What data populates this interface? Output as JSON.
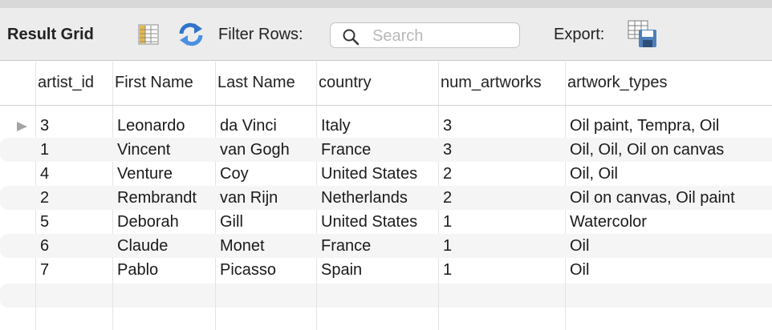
{
  "toolbar": {
    "title": "Result Grid",
    "filter_label": "Filter Rows:",
    "search_placeholder": "Search",
    "export_label": "Export:",
    "icons": [
      "form-editor-icon",
      "refresh-icon",
      "search-icon",
      "export-icon"
    ]
  },
  "grid": {
    "columns": [
      "artist_id",
      "First Name",
      "Last Name",
      "country",
      "num_artworks",
      "artwork_types"
    ],
    "rows": [
      [
        "3",
        "Leonardo",
        "da Vinci",
        "Italy",
        "3",
        "Oil paint, Tempra, Oil"
      ],
      [
        "1",
        "Vincent",
        "van Gogh",
        "France",
        "3",
        "Oil, Oil, Oil on canvas"
      ],
      [
        "4",
        "Venture",
        "Coy",
        "United States",
        "2",
        "Oil, Oil"
      ],
      [
        "2",
        "Rembrandt",
        "van Rijn",
        "Netherlands",
        "2",
        "Oil on canvas, Oil paint"
      ],
      [
        "5",
        "Deborah",
        "Gill",
        "United States",
        "1",
        "Watercolor"
      ],
      [
        "6",
        "Claude",
        "Monet",
        "France",
        "1",
        "Oil"
      ],
      [
        "7",
        "Pablo",
        "Picasso",
        "Spain",
        "1",
        "Oil"
      ]
    ]
  },
  "colors": {
    "toolbar_bg": "#ececec",
    "alt_row": "#f5f5f5",
    "refresh_icon": "#2f74c9",
    "form_icon": "#d7a83c"
  }
}
